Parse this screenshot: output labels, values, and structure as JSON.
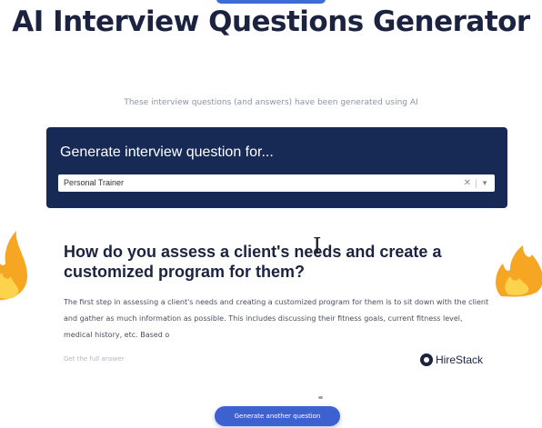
{
  "header": {
    "title": "AI Interview Questions Generator",
    "subtitle": "These interview questions (and answers) have been generated using AI"
  },
  "generator": {
    "heading": "Generate interview question for...",
    "selected_role": "Personal Trainer",
    "clear_icon": "clear-icon",
    "dropdown_icon": "chevron-down-icon"
  },
  "result": {
    "question": "How do you assess a client's needs and create a customized program for them?",
    "answer": "The first step in assessing a client's needs and creating a customized program for them is to sit down with the client and gather as much information as possible. This includes discussing their fitness goals, current fitness level, medical history, etc. Based o",
    "footnote": "Get the full answer",
    "brand": "HireStack"
  },
  "actions": {
    "generate_label": "Generate another question"
  },
  "colors": {
    "panel": "#172a55",
    "title": "#1b2340",
    "button": "#3d62cf",
    "flame_outer": "#f6a623",
    "flame_inner": "#fdd34d"
  }
}
